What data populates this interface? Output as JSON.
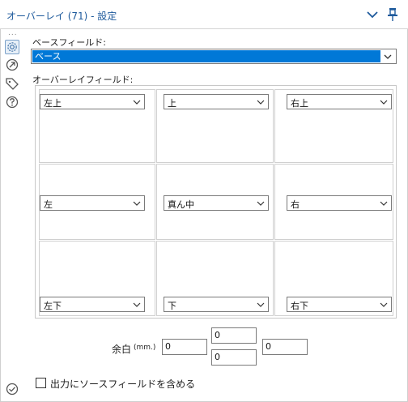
{
  "window": {
    "title": "オーバーレイ (71) - 設定",
    "icons": [
      "chevron-down-icon",
      "pin-icon"
    ]
  },
  "sidebar": {
    "dots": "...",
    "icons": [
      "gear-icon",
      "connection-icon",
      "tag-icon",
      "help-icon",
      "check-circle-icon"
    ],
    "active": "gear-icon"
  },
  "form": {
    "base_field_label": "ベースフィールド:",
    "base_field_value": "ベース",
    "overlay_field_label": "オーバーレイフィールド:",
    "cells": [
      {
        "value": "左上"
      },
      {
        "value": "上"
      },
      {
        "value": "右上"
      },
      {
        "value": "左"
      },
      {
        "value": "真ん中"
      },
      {
        "value": "右"
      },
      {
        "value": "左下"
      },
      {
        "value": "下"
      },
      {
        "value": "右下"
      }
    ],
    "margin_label": "余白",
    "margin_unit": "(mm.)",
    "margin_top": "0",
    "margin_left": "0",
    "margin_right": "0",
    "margin_bottom": "0",
    "include_source_label": "出力にソースフィールドを含める",
    "include_source_checked": false
  },
  "colors": {
    "title": "#1e5a9c",
    "selection": "#0078d7"
  }
}
